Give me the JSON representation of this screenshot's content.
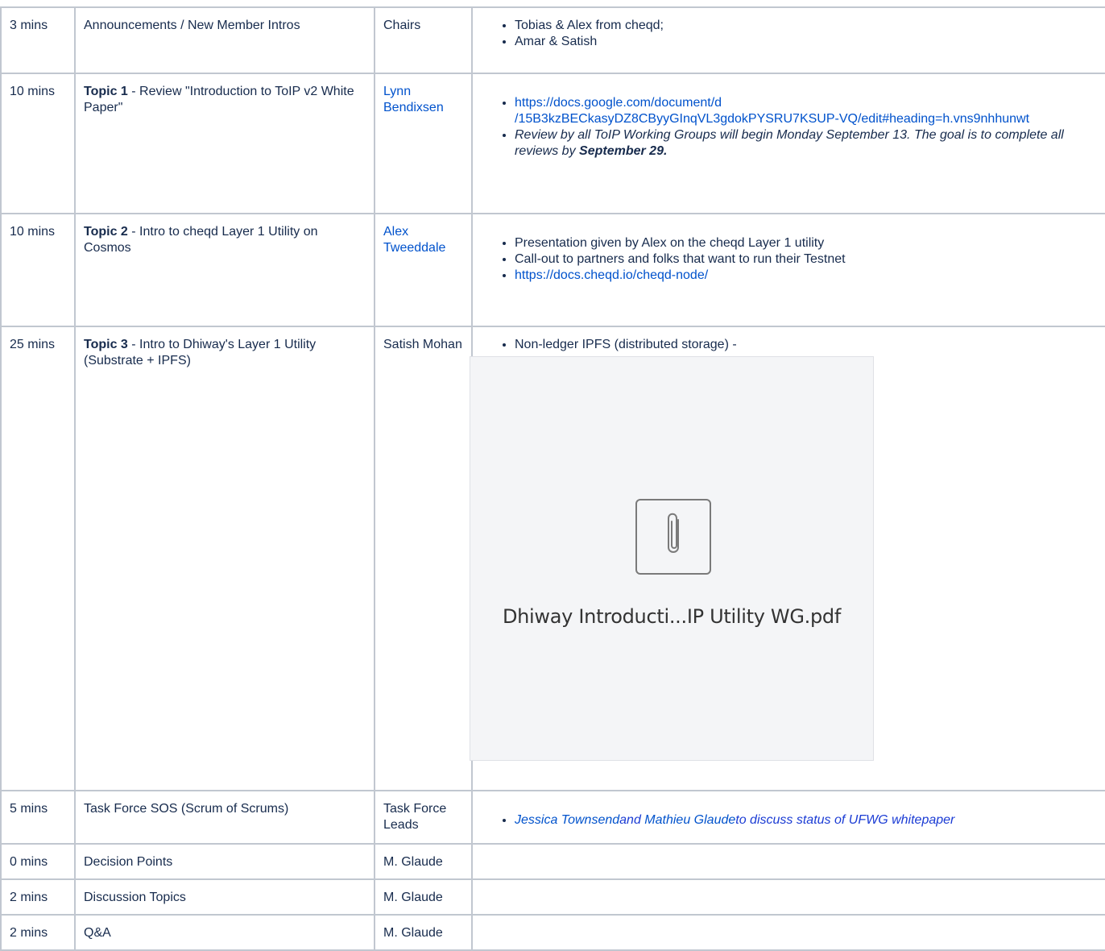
{
  "rows": [
    {
      "time": "3 mins",
      "item": "Announcements / New Member Intros",
      "who": "Chairs",
      "notes": [
        "Tobias & Alex from cheqd;",
        "Amar & Satish"
      ]
    },
    {
      "time": "10 mins",
      "item_bold": "Topic 1",
      "item_rest": " - Review \"Introduction to ToIP v2 White Paper\"",
      "who": "Lynn Bendixsen",
      "link_line1": "https://docs.google.com/document/d",
      "link_line2": "/15B3kzBECkasyDZ8CByyGInqVL3gdokPYSRU7KSUP-VQ/edit#heading=h.vns9nhhunwt",
      "review_text": "Review by all ToIP Working Groups will begin Monday September 13. The goal is to complete all reviews by ",
      "review_bold": "September 29."
    },
    {
      "time": "10 mins",
      "item_bold": "Topic 2",
      "item_rest": " - Intro to cheqd Layer 1 Utility on Cosmos",
      "who": "Alex Tweeddale",
      "notes": [
        "Presentation given by Alex on the cheqd Layer 1 utility",
        "Call-out to partners and folks that want to run their Testnet"
      ],
      "link": "https://docs.cheqd.io/cheqd-node/"
    },
    {
      "time": "25 mins",
      "item_bold": "Topic 3",
      "item_rest": " - Intro to Dhiway's Layer 1 Utility (Substrate + IPFS)",
      "who": "Satish Mohan",
      "note": "Non-ledger  IPFS (distributed storage) -",
      "attachment_name": "Dhiway Introducti...IP Utility WG.pdf",
      "attachment_icon": "paperclip-icon"
    },
    {
      "time": "5 mins",
      "item": "Task Force SOS (Scrum of Scrums)",
      "who": "Task Force Leads",
      "mention1": "Jessica Townsend",
      "joiner": "and ",
      "mention2": "Mathieu Glaude",
      "tail": "to discuss status of UFWG whitepaper"
    },
    {
      "time": "0 mins",
      "item": "Decision Points",
      "who": "M. Glaude"
    },
    {
      "time": "2 mins",
      "item": "Discussion Topics",
      "who": "M. Glaude"
    },
    {
      "time": "2 mins",
      "item": "Q&A",
      "who": "M. Glaude"
    }
  ]
}
